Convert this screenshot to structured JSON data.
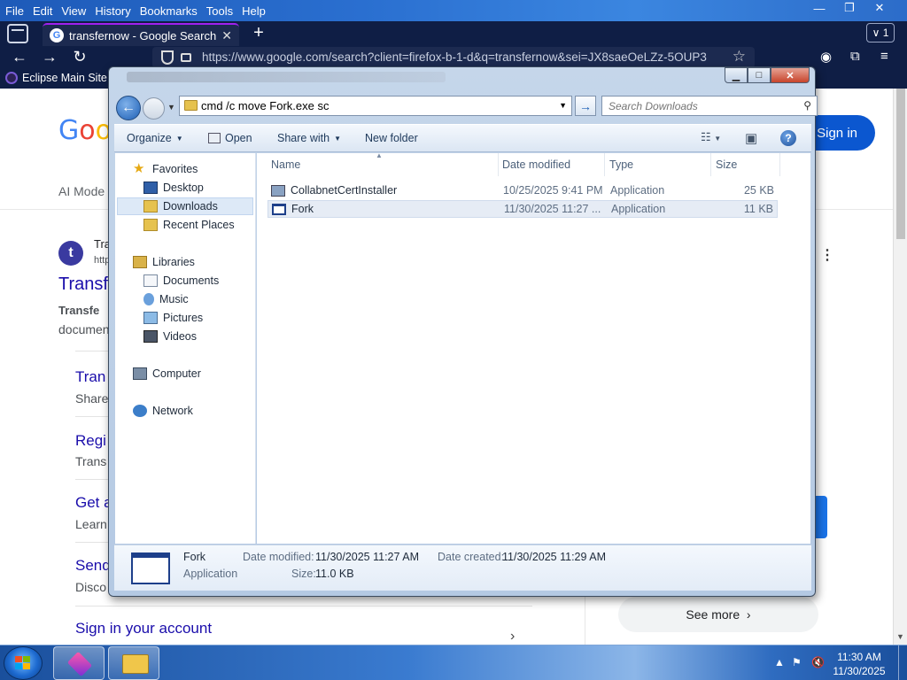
{
  "browser": {
    "menu": [
      "File",
      "Edit",
      "View",
      "History",
      "Bookmarks",
      "Tools",
      "Help"
    ],
    "tab": {
      "title": "transfernow - Google Search",
      "favicon": "G"
    },
    "tab_count": "1",
    "url": "https://www.google.com/search?client=firefox-b-1-d&q=transfernow&sei=JX8saeOeLZz-5OUP3",
    "bookmark": "Eclipse Main Site"
  },
  "page": {
    "logo": [
      "G",
      "o",
      "o"
    ],
    "ai_mode": "AI Mode",
    "sign_in": "Sign in",
    "result": {
      "icon": "t",
      "site": "Tra",
      "url": "http",
      "title": "Transf",
      "snippet_bold": "Transfe",
      "snippet": "documen"
    },
    "sublinks": [
      {
        "title": "Tran",
        "desc": "Share"
      },
      {
        "title": "Regi",
        "desc": "Trans"
      },
      {
        "title": "Get a",
        "desc": "Learn"
      },
      {
        "title": "Send",
        "desc": "Disco"
      }
    ],
    "sign_in_account": "Sign in your account",
    "see_more": "See more"
  },
  "dialog": {
    "address_value": "cmd /c move Fork.exe sc",
    "search_placeholder": "Search Downloads",
    "toolbar": {
      "organize": "Organize",
      "open": "Open",
      "share_with": "Share with",
      "new_folder": "New folder"
    },
    "nav": {
      "favorites": "Favorites",
      "desktop": "Desktop",
      "downloads": "Downloads",
      "recent_places": "Recent Places",
      "libraries": "Libraries",
      "documents": "Documents",
      "music": "Music",
      "pictures": "Pictures",
      "videos": "Videos",
      "computer": "Computer",
      "network": "Network"
    },
    "columns": {
      "name": "Name",
      "date": "Date modified",
      "type": "Type",
      "size": "Size"
    },
    "files": [
      {
        "name": "CollabnetCertInstaller",
        "date": "10/25/2025 9:41 PM",
        "type": "Application",
        "size": "25 KB"
      },
      {
        "name": "Fork",
        "date": "11/30/2025 11:27 ...",
        "type": "Application",
        "size": "11 KB"
      }
    ],
    "details": {
      "name": "Fork",
      "type": "Application",
      "date_modified_label": "Date modified:",
      "date_modified": "11/30/2025 11:27 AM",
      "date_created_label": "Date created:",
      "date_created": "11/30/2025 11:29 AM",
      "size_label": "Size:",
      "size": "11.0 KB"
    }
  },
  "taskbar": {
    "time": "11:30 AM",
    "date": "11/30/2025"
  }
}
